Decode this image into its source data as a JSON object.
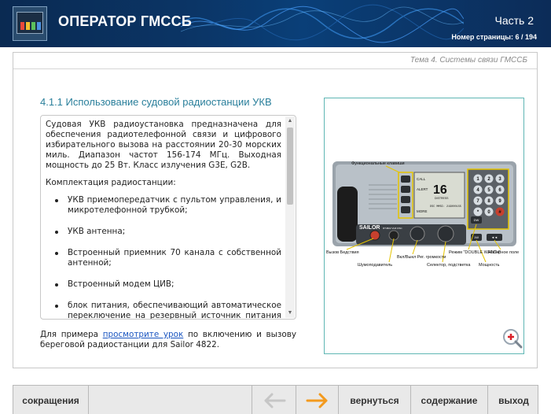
{
  "header": {
    "app_title": "ОПЕРАТОР ГМССБ",
    "part": "Часть 2",
    "page_number": "Номер страницы: 6 / 194"
  },
  "topic": "Тема 4. Системы связи ГМССБ",
  "section_title": "4.1.1 Использование судовой радиостанции УКВ",
  "body": {
    "intro": "Судовая УКВ радиоустановка предназначена для обеспечения радиотелефонной связи и цифрового избирательного вызова на расстоянии 20-30 морских миль. Диапазон частот 156-174 МГц. Выходная мощность до 25 Вт. Класс излучения G3E, G2B.",
    "kit_heading": "Комплектация радиостанции:",
    "kit_items": [
      "УКВ приемопередатчик с пультом управления, и микротелефонной трубкой;",
      "УКВ антенна;",
      "Встроенный приемник 70 канала с собственной антенной;",
      "Встроенный модем ЦИВ;",
      "блок питания, обеспечивающий автоматическое переключение на резервный источник питания при"
    ]
  },
  "footer_text": {
    "before": "Для примера ",
    "link": "просмотрите урок",
    "after": " по включению и вызову береговой радиостанции для Sailor 4822."
  },
  "radio_image": {
    "labels": {
      "func_keys": "Функциональные клавиши",
      "distress": "Вызов Бедствия",
      "squelch": "Шумоподавитель",
      "power_volume": "Вкл/Выкл Рег. громкости",
      "selector": "Селектор, подстветка",
      "dual_watch_mode": "Режим \"DOUBLE WATCH\"",
      "power": "Мощность",
      "keypad": "Наборное поле"
    },
    "screen": {
      "call": "CALL",
      "alert": "ALERT",
      "channel": "16",
      "distress": "DISTRESS",
      "more": "MORE",
      "info": "DSC  MMSI: 219000155",
      "brand": "SAILOR",
      "model": "RT4822 VHF DSC"
    },
    "keys": [
      "1",
      "2",
      "3",
      "4",
      "5",
      "6",
      "7",
      "8",
      "9",
      "*",
      "0",
      "#"
    ],
    "side_keys": [
      "DW",
      "1W",
      "◄◄"
    ]
  },
  "nav": {
    "abbreviations": "сокращения",
    "back": "вернуться",
    "contents": "содержание",
    "exit": "выход"
  },
  "colors": {
    "header_bg": "#0b3566",
    "accent_title": "#2a7f9b",
    "link": "#1a55c0",
    "next_arrow": "#f39a1e",
    "prev_arrow_disabled": "#c6c6c6",
    "frame": "#5fb6b4"
  }
}
